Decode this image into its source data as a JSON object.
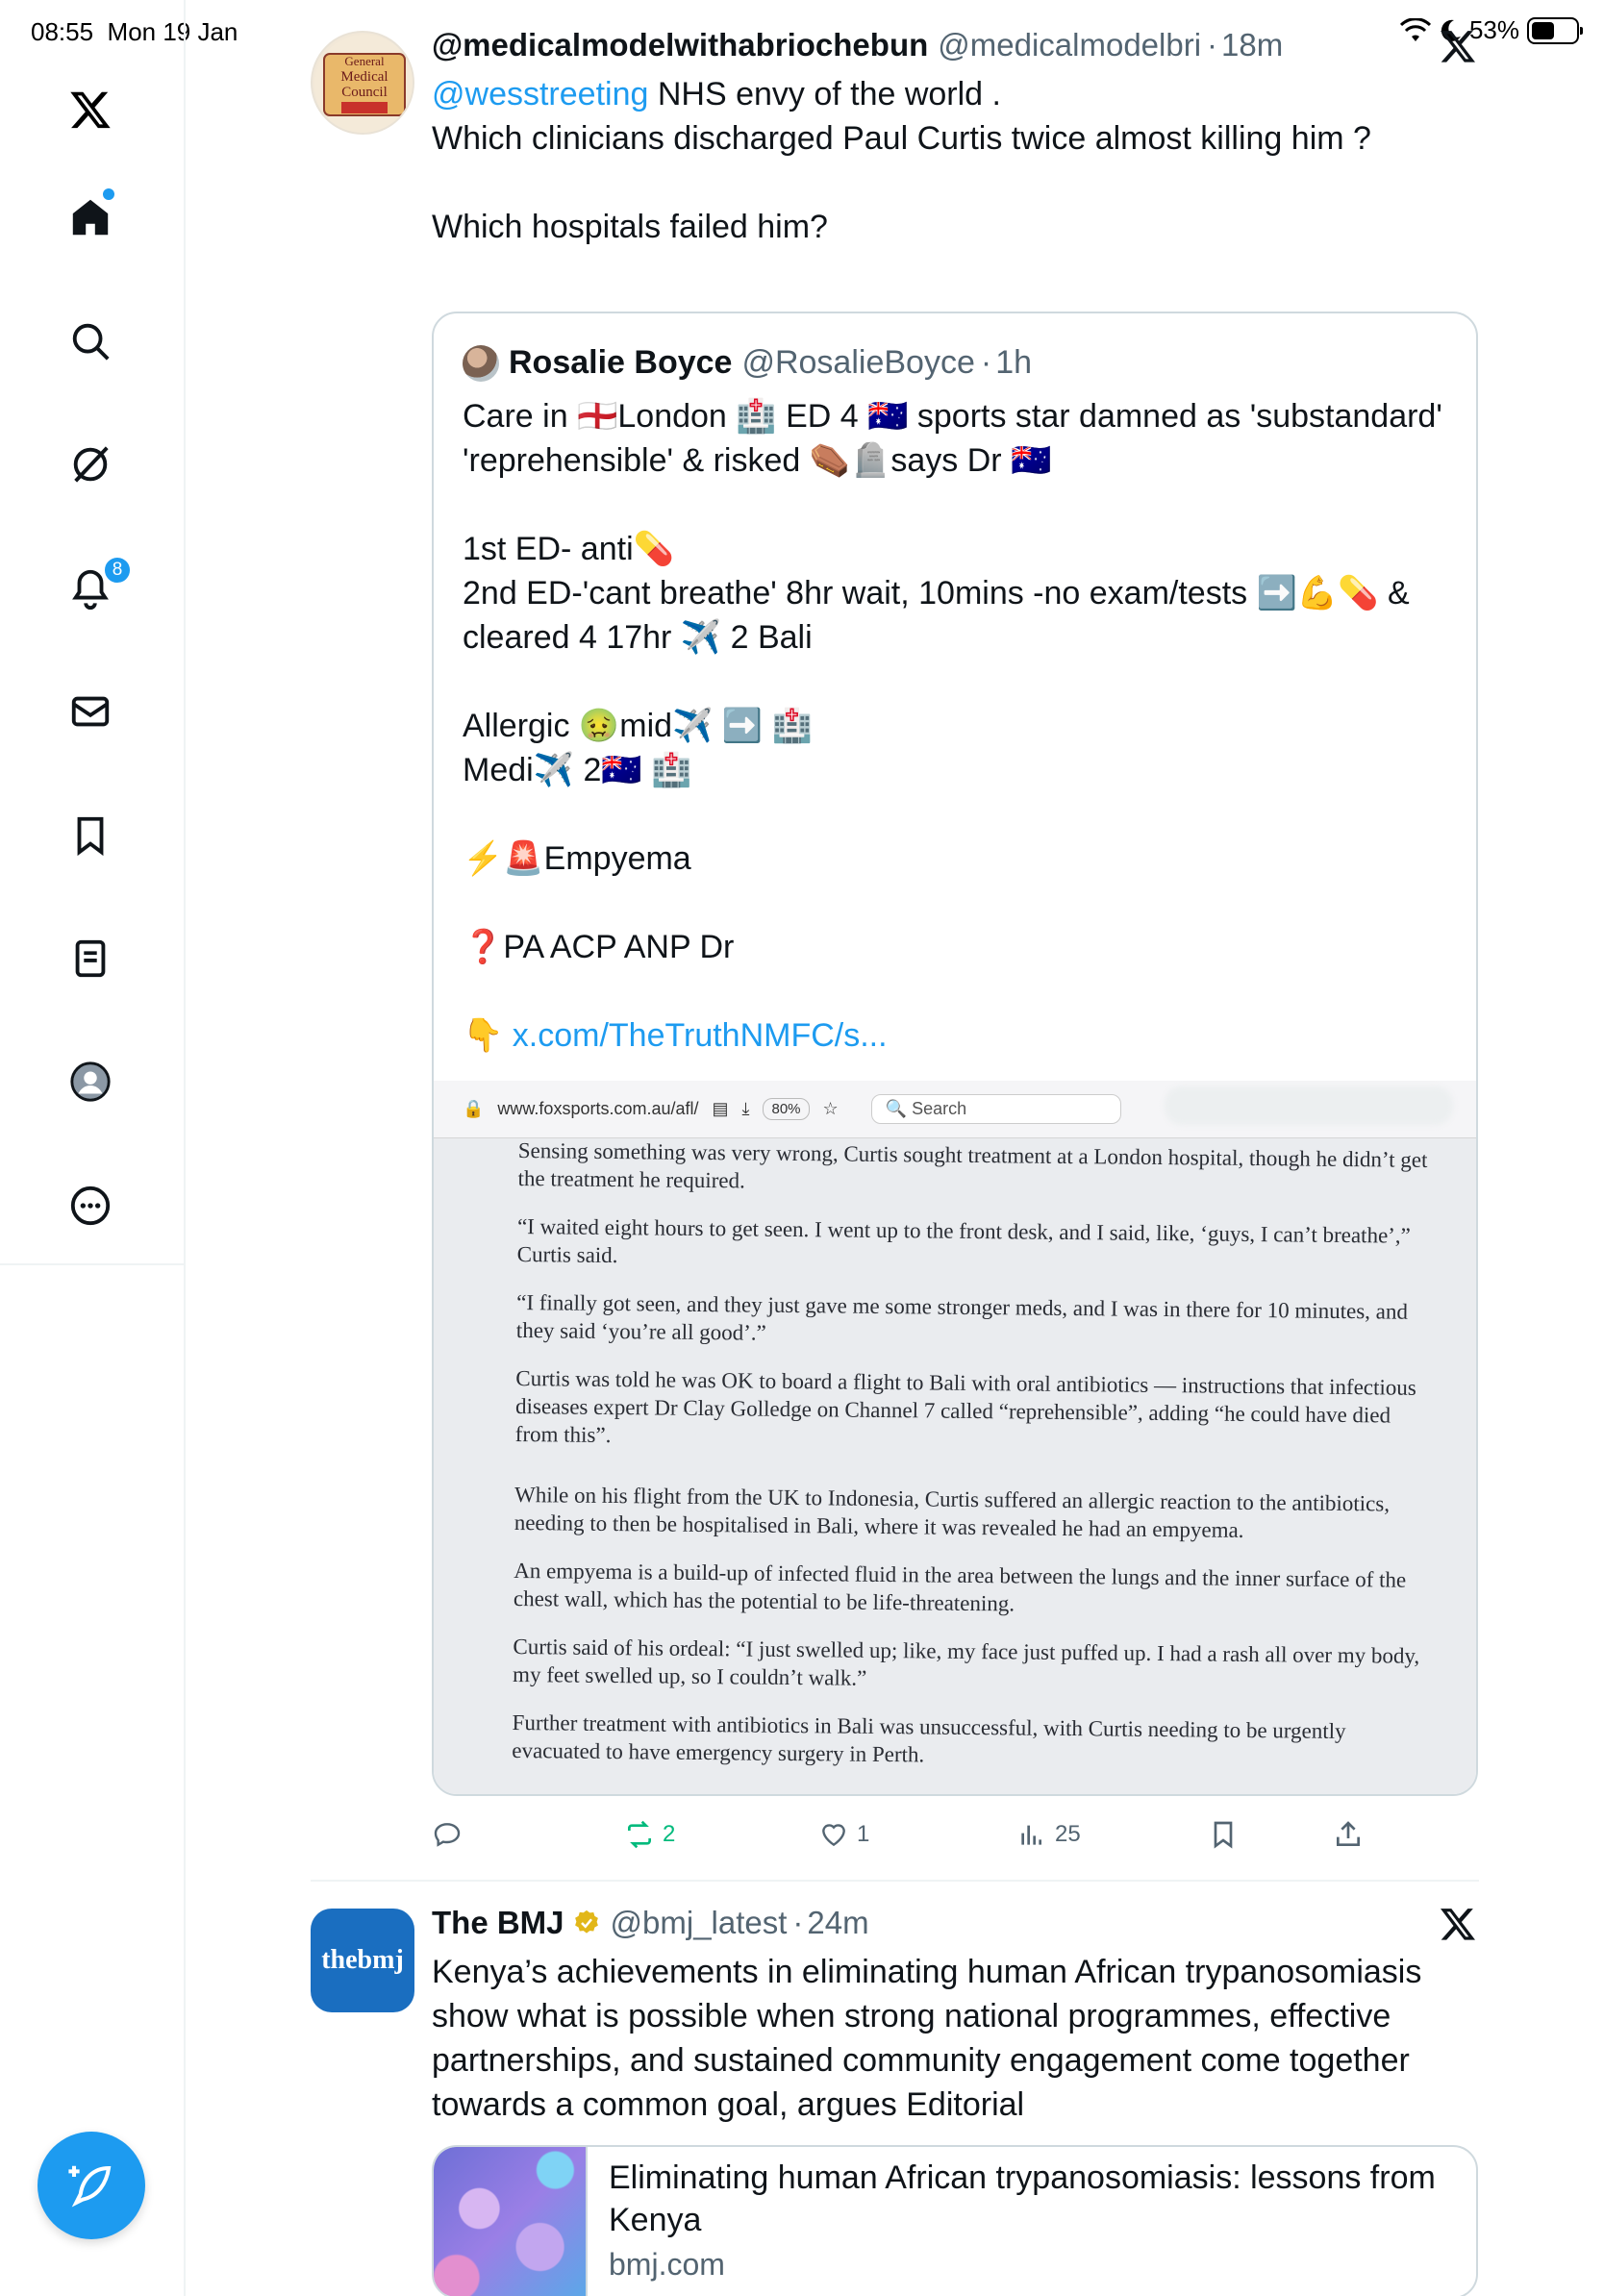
{
  "status_bar": {
    "time": "08:55",
    "date": "Mon 19 Jan",
    "battery": "53%"
  },
  "sidebar": {
    "items": [
      {
        "name": "x-logo-icon"
      },
      {
        "name": "home-icon"
      },
      {
        "name": "search-icon"
      },
      {
        "name": "grok-icon"
      },
      {
        "name": "notifications-icon"
      },
      {
        "name": "messages-icon"
      },
      {
        "name": "bookmarks-icon"
      },
      {
        "name": "lists-icon"
      },
      {
        "name": "profile-icon"
      },
      {
        "name": "more-icon"
      }
    ],
    "notification_count": "8"
  },
  "post1": {
    "name": "@medicalmodelwithabriochebun",
    "handle": "@medicalmodelbri",
    "time": "18m",
    "mention": "@wesstreeting",
    "text_line1": " NHS envy of the world .",
    "text_rest": "\nWhich clinicians discharged Paul Curtis twice almost killing him ?\n\nWhich hospitals failed him?",
    "avatar_text": [
      "General",
      "Medical",
      "Council"
    ],
    "quote": {
      "name": "Rosalie Boyce",
      "handle": "@RosalieBoyce",
      "time": "1h",
      "text": "Care in 🏴󠁧󠁢󠁥󠁮󠁧󠁿London 🏥 ED 4 🇦🇺 sports star damned as 'substandard' 'reprehensible' & risked ⚰️🪦says Dr 🇦🇺\n\n1st ED- anti💊\n2nd ED-'cant breathe' 8hr wait, 10mins -no exam/tests ➡️💪💊 &\ncleared 4 17hr ✈️ 2 Bali\n\nAllergic 🤢mid✈️ ➡️ 🏥\nMedi✈️ 2🇦🇺 🏥\n\n⚡️🚨Empyema\n\n❓PA ACP ANP Dr\n\n👇 ",
      "link": "x.com/TheTruthNMFC/s...",
      "browser": {
        "url": "www.foxsports.com.au/afl/",
        "zoom": "80%",
        "search_placeholder": "Search"
      },
      "article_paragraphs": [
        "Sensing something was very wrong, Curtis sought treatment at a London hospital, though he didn’t get the treatment he required.",
        "“I waited eight hours to get seen. I went up to the front desk, and I said, like, ‘guys, I can’t breathe’,” Curtis said.",
        "“I finally got seen, and they just gave me some stronger meds, and I was in there for 10 minutes, and they said ‘you’re all good’.”",
        "Curtis was told he was OK to board a flight to Bali with oral antibiotics — instructions that infectious diseases expert Dr Clay Golledge on Channel 7 called “reprehensible”, adding “he could have died from this”.",
        "While on his flight from the UK to Indonesia, Curtis suffered an allergic reaction to the antibiotics, needing to then be hospitalised in Bali, where it was revealed he had an empyema.",
        "An empyema is a build-up of infected fluid in the area between the lungs and the inner surface of the chest wall, which has the potential to be life-threatening.",
        "Curtis said of his ordeal: “I just swelled up; like, my face just puffed up. I had a rash all over my body, my feet swelled up, so I couldn’t walk.”",
        "Further treatment with antibiotics in Bali was unsuccessful, with Curtis needing to be urgently evacuated to have emergency surgery in Perth."
      ]
    },
    "actions": {
      "reposts": "2",
      "likes": "1",
      "views": "25"
    }
  },
  "post2": {
    "name": "The BMJ",
    "handle": "@bmj_latest",
    "time": "24m",
    "avatar_text": "thebmj",
    "text": "Kenya’s achievements in eliminating human African trypanosomiasis show what is possible when strong national programmes, effective partnerships, and sustained community engagement come together towards a common goal, argues Editorial",
    "card": {
      "title": "Eliminating human African trypanosomiasis: lessons from Kenya",
      "domain": "bmj.com"
    }
  },
  "colors": {
    "accent": "#1d9bf0",
    "text": "#0f1419",
    "muted": "#536471",
    "repost_green": "#00ba7c"
  }
}
